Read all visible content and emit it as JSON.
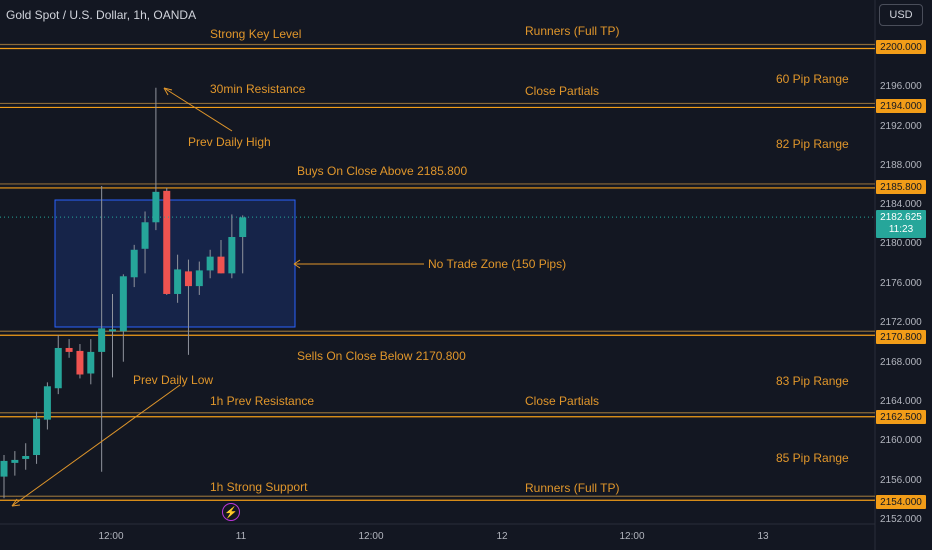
{
  "header": {
    "symbol_line": "Gold Spot / U.S. Dollar, 1h, OANDA",
    "currency": "USD"
  },
  "price_scale": {
    "ticks": [
      "2196.000",
      "2192.000",
      "2188.000",
      "2184.000",
      "2180.000",
      "2176.000",
      "2172.000",
      "2168.000",
      "2164.000",
      "2160.000",
      "2156.000",
      "2152.000"
    ],
    "level_badges": [
      "2200.000",
      "2194.000",
      "2185.800",
      "2170.800",
      "2162.500",
      "2154.000"
    ],
    "current_price": "2182.625",
    "countdown": "11:23"
  },
  "time_scale": {
    "ticks": [
      "12:00",
      "11",
      "12:00",
      "12",
      "12:00",
      "13"
    ]
  },
  "annotations": {
    "strong_key_level": "Strong Key Level",
    "runners_top": "Runners (Full TP)",
    "min30_resistance": "30min Resistance",
    "close_partials_top": "Close Partials",
    "range_60": "60 Pip Range",
    "prev_daily_high": "Prev Daily High",
    "range_82": "82 Pip Range",
    "buys_on_close": "Buys On Close Above 2185.800",
    "no_trade_zone": "No Trade Zone (150 Pips)",
    "sells_on_close": "Sells On Close Below 2170.800",
    "prev_daily_low": "Prev Daily Low",
    "range_83": "83 Pip Range",
    "h1_prev_resistance": "1h Prev Resistance",
    "close_partials_bottom": "Close Partials",
    "range_85": "85 Pip Range",
    "h1_strong_support": "1h Strong Support",
    "runners_bottom": "Runners (Full TP)"
  },
  "colors": {
    "background": "#131722",
    "bull": "#26a69a",
    "bear": "#ef5350",
    "level": "#f29d18",
    "annotation": "#e0962b",
    "zone": "#2962ff"
  },
  "chart_data": {
    "type": "candlestick",
    "title": "Gold Spot / U.S. Dollar, 1h, OANDA",
    "ylim": [
      2151,
      2203
    ],
    "horizontal_levels": [
      2200.0,
      2194.0,
      2185.8,
      2170.8,
      2162.5,
      2154.0
    ],
    "no_trade_zone": {
      "low": 2171.5,
      "high": 2184.8
    },
    "current_price": 2182.625,
    "candles": [
      {
        "o": 2156.2,
        "h": 2158.4,
        "l": 2154.0,
        "c": 2157.8
      },
      {
        "o": 2157.6,
        "h": 2158.8,
        "l": 2156.3,
        "c": 2157.9
      },
      {
        "o": 2158.0,
        "h": 2159.6,
        "l": 2156.9,
        "c": 2158.3
      },
      {
        "o": 2158.4,
        "h": 2162.8,
        "l": 2157.5,
        "c": 2162.1
      },
      {
        "o": 2162.0,
        "h": 2165.8,
        "l": 2161.0,
        "c": 2165.4
      },
      {
        "o": 2165.2,
        "h": 2170.6,
        "l": 2164.6,
        "c": 2169.3
      },
      {
        "o": 2169.3,
        "h": 2170.2,
        "l": 2168.3,
        "c": 2168.9
      },
      {
        "o": 2169.0,
        "h": 2169.7,
        "l": 2166.2,
        "c": 2166.6
      },
      {
        "o": 2166.7,
        "h": 2170.2,
        "l": 2165.6,
        "c": 2168.9
      },
      {
        "o": 2168.9,
        "h": 2185.8,
        "l": 2156.7,
        "c": 2171.3
      },
      {
        "o": 2171.0,
        "h": 2174.8,
        "l": 2166.3,
        "c": 2171.2
      },
      {
        "o": 2171.0,
        "h": 2176.8,
        "l": 2167.9,
        "c": 2176.6
      },
      {
        "o": 2176.5,
        "h": 2179.8,
        "l": 2175.5,
        "c": 2179.3
      },
      {
        "o": 2179.4,
        "h": 2183.2,
        "l": 2176.9,
        "c": 2182.1
      },
      {
        "o": 2182.1,
        "h": 2195.8,
        "l": 2181.3,
        "c": 2185.2
      },
      {
        "o": 2185.3,
        "h": 2185.6,
        "l": 2174.7,
        "c": 2174.8
      },
      {
        "o": 2174.8,
        "h": 2178.8,
        "l": 2173.9,
        "c": 2177.3
      },
      {
        "o": 2177.1,
        "h": 2178.3,
        "l": 2168.6,
        "c": 2175.6
      },
      {
        "o": 2175.6,
        "h": 2178.1,
        "l": 2174.7,
        "c": 2177.2
      },
      {
        "o": 2177.2,
        "h": 2179.3,
        "l": 2176.4,
        "c": 2178.6
      },
      {
        "o": 2178.6,
        "h": 2180.3,
        "l": 2176.9,
        "c": 2176.9
      },
      {
        "o": 2176.9,
        "h": 2182.9,
        "l": 2176.4,
        "c": 2180.6
      },
      {
        "o": 2180.6,
        "h": 2182.8,
        "l": 2176.9,
        "c": 2182.6
      }
    ]
  }
}
